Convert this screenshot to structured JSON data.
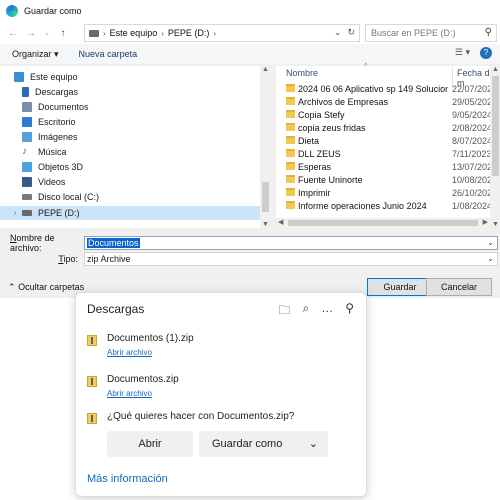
{
  "window": {
    "title": "Guardar como"
  },
  "address": {
    "crumbs": [
      "Este equipo",
      "PEPE (D:)"
    ],
    "search_placeholder": "Buscar en PEPE (D:)"
  },
  "toolbar": {
    "organize": "Organizar ▾",
    "new_folder": "Nueva carpeta"
  },
  "nav": {
    "items": [
      {
        "label": "Este equipo",
        "icon": "monitor-icon",
        "color": "#3a8fd8"
      },
      {
        "label": "Descargas",
        "icon": "download-arrow-icon",
        "color": "#2b6cb0"
      },
      {
        "label": "Documentos",
        "icon": "document-icon",
        "color": "#7a8ea8"
      },
      {
        "label": "Escritorio",
        "icon": "desktop-icon",
        "color": "#2e7bd1"
      },
      {
        "label": "Imágenes",
        "icon": "pictures-icon",
        "color": "#5a9fd4"
      },
      {
        "label": "Música",
        "icon": "music-note-icon",
        "color": "#2b6cb0"
      },
      {
        "label": "Objetos 3D",
        "icon": "cube-icon",
        "color": "#4aa3df"
      },
      {
        "label": "Videos",
        "icon": "video-icon",
        "color": "#3a5a8a"
      },
      {
        "label": "Disco local (C:)",
        "icon": "drive-icon",
        "color": "#7a7a7a"
      },
      {
        "label": "PEPE (D:)",
        "icon": "drive-icon",
        "color": "#6a6a6a"
      }
    ]
  },
  "files": {
    "col_name": "Nombre",
    "col_date": "Fecha de m",
    "rows": [
      {
        "name": "2024 06 06 Aplicativo sp 149 Solucion fac...",
        "date": "22/07/2024"
      },
      {
        "name": "Archivos de Empresas",
        "date": "29/05/2024"
      },
      {
        "name": "Copia Stefy",
        "date": "9/05/2024 3"
      },
      {
        "name": "copia zeus fridas",
        "date": "2/08/2024 5"
      },
      {
        "name": "Dieta",
        "date": "8/07/2024 1"
      },
      {
        "name": "DLL ZEUS",
        "date": "7/11/2023 3"
      },
      {
        "name": "Esperas",
        "date": "13/07/2023"
      },
      {
        "name": "Fuente Uninorte",
        "date": "10/08/2023"
      },
      {
        "name": "Imprimir",
        "date": "26/10/2023"
      },
      {
        "name": "Informe operaciones Junio 2024",
        "date": "1/08/2024 4"
      }
    ]
  },
  "form": {
    "filename_label_pre": "",
    "filename_label_u": "N",
    "filename_label_post": "ombre de archivo:",
    "filename_value": "Documentos",
    "type_label_u": "T",
    "type_label_post": "ipo:",
    "type_value": "zip Archive"
  },
  "footer": {
    "hide_folders": "Ocultar carpetas",
    "save": "Guardar",
    "cancel": "Cancelar"
  },
  "downloads": {
    "title": "Descargas",
    "items": [
      {
        "name": "Documentos (1).zip",
        "link": "Abrir archivo"
      },
      {
        "name": "Documentos.zip",
        "link": "Abrir archivo"
      }
    ],
    "question": "¿Qué quieres hacer con Documentos.zip?",
    "open_button": "Abrir",
    "save_as_button": "Guardar como",
    "more_info": "Más información"
  }
}
